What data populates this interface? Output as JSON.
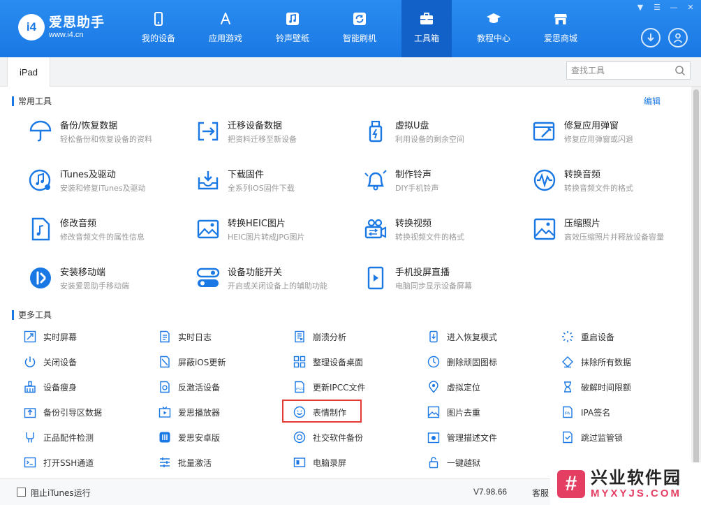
{
  "app": {
    "logo_mark": "i4",
    "logo_name": "爱思助手",
    "logo_url": "www.i4.cn"
  },
  "nav": [
    {
      "label": "我的设备",
      "icon": "phone-icon"
    },
    {
      "label": "应用游戏",
      "icon": "app-store-icon"
    },
    {
      "label": "铃声壁纸",
      "icon": "music-note-icon"
    },
    {
      "label": "智能刷机",
      "icon": "refresh-box-icon"
    },
    {
      "label": "工具箱",
      "icon": "toolbox-icon",
      "active": true
    },
    {
      "label": "教程中心",
      "icon": "graduation-cap-icon"
    },
    {
      "label": "爱思商城",
      "icon": "shop-icon"
    }
  ],
  "window_controls": [
    "shirt-icon",
    "menu-icon",
    "minimize-icon",
    "close-icon"
  ],
  "tabbar": {
    "device_tab": "iPad",
    "search_placeholder": "查找工具"
  },
  "sections": {
    "common_title": "常用工具",
    "edit_label": "编辑",
    "more_title": "更多工具"
  },
  "common_tools": [
    {
      "title": "备份/恢复数据",
      "desc": "轻松备份和恢复设备的资料",
      "icon": "umbrella-icon"
    },
    {
      "title": "迁移设备数据",
      "desc": "把资料迁移至新设备",
      "icon": "migrate-icon"
    },
    {
      "title": "虚拟U盘",
      "desc": "利用设备的剩余空间",
      "icon": "usb-drive-icon"
    },
    {
      "title": "修复应用弹窗",
      "desc": "修复应用弹窗或闪退",
      "icon": "repair-window-icon"
    },
    {
      "title": "iTunes及驱动",
      "desc": "安装和修复iTunes及驱动",
      "icon": "itunes-icon"
    },
    {
      "title": "下载固件",
      "desc": "全系列iOS固件下载",
      "icon": "download-tray-icon"
    },
    {
      "title": "制作铃声",
      "desc": "DIY手机铃声",
      "icon": "bell-icon"
    },
    {
      "title": "转换音频",
      "desc": "转换音频文件的格式",
      "icon": "audio-wave-icon"
    },
    {
      "title": "修改音频",
      "desc": "修改音频文件的属性信息",
      "icon": "audio-file-icon"
    },
    {
      "title": "转换HEIC图片",
      "desc": "HEIC图片转成JPG图片",
      "icon": "heic-image-icon"
    },
    {
      "title": "转换视频",
      "desc": "转换视频文件的格式",
      "icon": "video-convert-icon"
    },
    {
      "title": "压缩照片",
      "desc": "高效压缩照片并释放设备容量",
      "icon": "compress-photo-icon"
    },
    {
      "title": "安装移动端",
      "desc": "安装爱思助手移动端",
      "icon": "i4-mobile-icon"
    },
    {
      "title": "设备功能开关",
      "desc": "开启或关闭设备上的辅助功能",
      "icon": "toggle-icon"
    },
    {
      "title": "手机投屏直播",
      "desc": "电脑同步显示设备屏幕",
      "icon": "screen-cast-icon"
    }
  ],
  "more_tools": [
    {
      "label": "实时屏幕",
      "icon": "realtime-screen-icon"
    },
    {
      "label": "实时日志",
      "icon": "log-icon"
    },
    {
      "label": "崩溃分析",
      "icon": "crash-analysis-icon"
    },
    {
      "label": "进入恢复模式",
      "icon": "recovery-mode-icon"
    },
    {
      "label": "重启设备",
      "icon": "restart-icon"
    },
    {
      "label": "关闭设备",
      "icon": "power-icon"
    },
    {
      "label": "屏蔽iOS更新",
      "icon": "block-update-icon"
    },
    {
      "label": "整理设备桌面",
      "icon": "grid-icon"
    },
    {
      "label": "删除顽固图标",
      "icon": "delete-icon-icon"
    },
    {
      "label": "抹除所有数据",
      "icon": "eraser-icon"
    },
    {
      "label": "设备瘦身",
      "icon": "broom-icon"
    },
    {
      "label": "反激活设备",
      "icon": "deactivate-icon"
    },
    {
      "label": "更新IPCC文件",
      "icon": "ipcc-icon"
    },
    {
      "label": "虚拟定位",
      "icon": "location-pin-icon"
    },
    {
      "label": "破解时间限额",
      "icon": "hourglass-icon"
    },
    {
      "label": "备份引导区数据",
      "icon": "backup-boot-icon"
    },
    {
      "label": "爱思播放器",
      "icon": "tv-player-icon"
    },
    {
      "label": "表情制作",
      "icon": "smiley-icon"
    },
    {
      "label": "图片去重",
      "icon": "dedupe-image-icon"
    },
    {
      "label": "IPA签名",
      "icon": "ipa-sign-icon"
    },
    {
      "label": "正品配件检测",
      "icon": "accessory-check-icon"
    },
    {
      "label": "爱思安卓版",
      "icon": "i4-android-icon"
    },
    {
      "label": "社交软件备份",
      "icon": "social-backup-icon"
    },
    {
      "label": "管理描述文件",
      "icon": "profile-gear-icon"
    },
    {
      "label": "跳过监管锁",
      "icon": "skip-lock-icon"
    },
    {
      "label": "打开SSH通道",
      "icon": "terminal-icon"
    },
    {
      "label": "批量激活",
      "icon": "batch-activate-icon"
    },
    {
      "label": "电脑录屏",
      "icon": "screen-record-icon"
    },
    {
      "label": "一键越狱",
      "icon": "jailbreak-lock-icon"
    }
  ],
  "footer": {
    "checkbox_label": "阻止iTunes运行",
    "checkbox_checked": false,
    "version": "V7.98.66",
    "service": "客服"
  },
  "watermark": {
    "logo": "#",
    "name": "兴业软件园",
    "url": "MYXYJS.COM"
  },
  "colors": {
    "header_blue": "#1a78e4",
    "accent": "#1a78e4",
    "highlight_red": "#e53935"
  }
}
